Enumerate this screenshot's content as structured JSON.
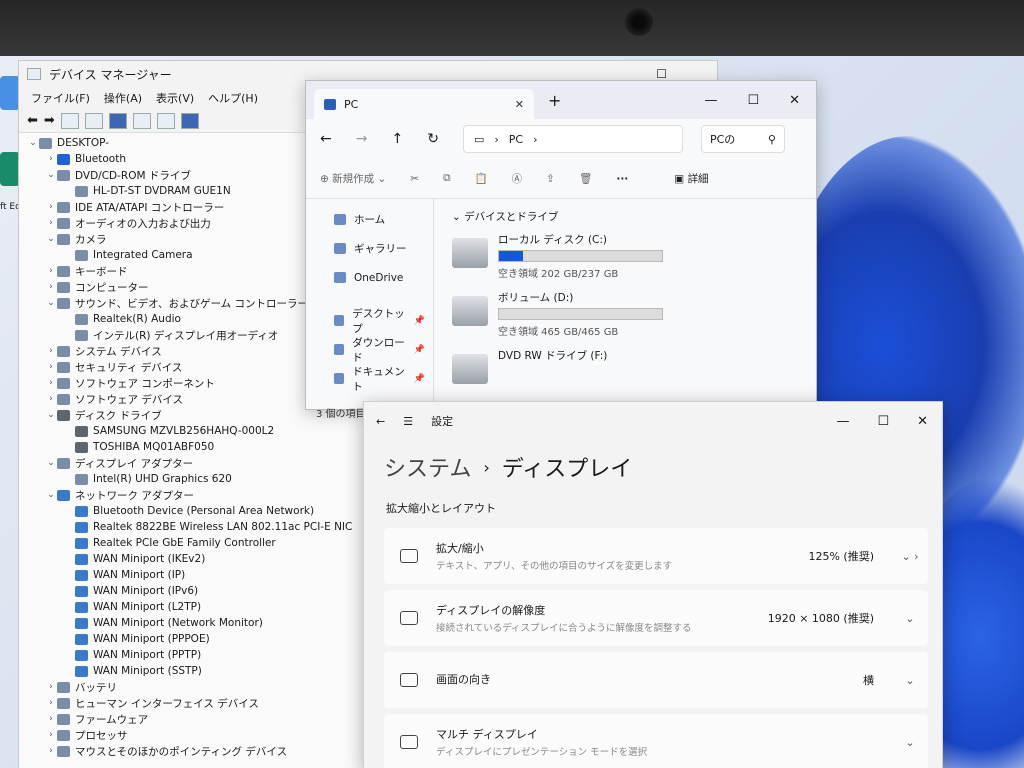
{
  "desktop": {
    "edge_label": "ft Edi"
  },
  "devmgr": {
    "title": "デバイス マネージャー",
    "menu": [
      "ファイル(F)",
      "操作(A)",
      "表示(V)",
      "ヘルプ(H)"
    ],
    "tree": [
      {
        "level": 0,
        "twisty": "v",
        "label": "DESKTOP-"
      },
      {
        "level": 1,
        "twisty": ">",
        "label": "Bluetooth",
        "icon": "bt"
      },
      {
        "level": 1,
        "twisty": "v",
        "label": "DVD/CD-ROM ドライブ"
      },
      {
        "level": 2,
        "twisty": "",
        "label": "HL-DT-ST DVDRAM GUE1N"
      },
      {
        "level": 1,
        "twisty": ">",
        "label": "IDE ATA/ATAPI コントローラー"
      },
      {
        "level": 1,
        "twisty": ">",
        "label": "オーディオの入力および出力"
      },
      {
        "level": 1,
        "twisty": "v",
        "label": "カメラ"
      },
      {
        "level": 2,
        "twisty": "",
        "label": "Integrated Camera"
      },
      {
        "level": 1,
        "twisty": ">",
        "label": "キーボード"
      },
      {
        "level": 1,
        "twisty": ">",
        "label": "コンピューター"
      },
      {
        "level": 1,
        "twisty": "v",
        "label": "サウンド、ビデオ、およびゲーム コントローラー"
      },
      {
        "level": 2,
        "twisty": "",
        "label": "Realtek(R) Audio"
      },
      {
        "level": 2,
        "twisty": "",
        "label": "インテル(R) ディスプレイ用オーディオ"
      },
      {
        "level": 1,
        "twisty": ">",
        "label": "システム デバイス"
      },
      {
        "level": 1,
        "twisty": ">",
        "label": "セキュリティ デバイス"
      },
      {
        "level": 1,
        "twisty": ">",
        "label": "ソフトウェア コンポーネント"
      },
      {
        "level": 1,
        "twisty": ">",
        "label": "ソフトウェア デバイス"
      },
      {
        "level": 1,
        "twisty": "v",
        "label": "ディスク ドライブ",
        "icon": "disk"
      },
      {
        "level": 2,
        "twisty": "",
        "label": "SAMSUNG MZVLB256HAHQ-000L2",
        "icon": "disk"
      },
      {
        "level": 2,
        "twisty": "",
        "label": "TOSHIBA MQ01ABF050",
        "icon": "disk"
      },
      {
        "level": 1,
        "twisty": "v",
        "label": "ディスプレイ アダプター"
      },
      {
        "level": 2,
        "twisty": "",
        "label": "Intel(R) UHD Graphics 620"
      },
      {
        "level": 1,
        "twisty": "v",
        "label": "ネットワーク アダプター",
        "icon": "net"
      },
      {
        "level": 2,
        "twisty": "",
        "label": "Bluetooth Device (Personal Area Network)",
        "icon": "net"
      },
      {
        "level": 2,
        "twisty": "",
        "label": "Realtek 8822BE Wireless LAN 802.11ac PCI-E NIC",
        "icon": "net"
      },
      {
        "level": 2,
        "twisty": "",
        "label": "Realtek PCIe GbE Family Controller",
        "icon": "net"
      },
      {
        "level": 2,
        "twisty": "",
        "label": "WAN Miniport (IKEv2)",
        "icon": "net"
      },
      {
        "level": 2,
        "twisty": "",
        "label": "WAN Miniport (IP)",
        "icon": "net"
      },
      {
        "level": 2,
        "twisty": "",
        "label": "WAN Miniport (IPv6)",
        "icon": "net"
      },
      {
        "level": 2,
        "twisty": "",
        "label": "WAN Miniport (L2TP)",
        "icon": "net"
      },
      {
        "level": 2,
        "twisty": "",
        "label": "WAN Miniport (Network Monitor)",
        "icon": "net"
      },
      {
        "level": 2,
        "twisty": "",
        "label": "WAN Miniport (PPPOE)",
        "icon": "net"
      },
      {
        "level": 2,
        "twisty": "",
        "label": "WAN Miniport (PPTP)",
        "icon": "net"
      },
      {
        "level": 2,
        "twisty": "",
        "label": "WAN Miniport (SSTP)",
        "icon": "net"
      },
      {
        "level": 1,
        "twisty": ">",
        "label": "バッテリ"
      },
      {
        "level": 1,
        "twisty": ">",
        "label": "ヒューマン インターフェイス デバイス"
      },
      {
        "level": 1,
        "twisty": ">",
        "label": "ファームウェア"
      },
      {
        "level": 1,
        "twisty": ">",
        "label": "プロセッサ"
      },
      {
        "level": 1,
        "twisty": ">",
        "label": "マウスとそのほかのポインティング デバイス"
      }
    ]
  },
  "explorer": {
    "tab_title": "PC",
    "address": "PC",
    "search_placeholder": "PCの",
    "new_label": "新規作成",
    "details_label": "詳細",
    "sidebar": [
      {
        "label": "ホーム",
        "pin": ""
      },
      {
        "label": "ギャラリー",
        "pin": ""
      },
      {
        "label": "OneDrive",
        "pin": ""
      },
      {
        "label": "デスクトップ",
        "pin": "📌"
      },
      {
        "label": "ダウンロード",
        "pin": "📌"
      },
      {
        "label": "ドキュメント",
        "pin": "📌"
      }
    ],
    "section": "デバイスとドライブ",
    "drives": [
      {
        "name": "ローカル ディスク (C:)",
        "free": "空き領域 202 GB/237 GB",
        "used_pct": 15,
        "bar": true
      },
      {
        "name": "ボリューム (D:)",
        "free": "空き領域 465 GB/465 GB",
        "used_pct": 0,
        "bar": true
      },
      {
        "name": "DVD RW ドライブ (F:)",
        "free": "",
        "used_pct": 0,
        "bar": false
      }
    ],
    "status": "3 個の項目"
  },
  "settings": {
    "app": "設定",
    "crumb_parent": "システム",
    "crumb_current": "ディスプレイ",
    "section": "拡大縮小とレイアウト",
    "items": [
      {
        "title": "拡大/縮小",
        "desc": "テキスト、アプリ、その他の項目のサイズを変更します",
        "value": "125% (推奨)",
        "chev": "⌄  ›"
      },
      {
        "title": "ディスプレイの解像度",
        "desc": "接続されているディスプレイに合うように解像度を調整する",
        "value": "1920 × 1080 (推奨)",
        "chev": "⌄"
      },
      {
        "title": "画面の向き",
        "desc": "",
        "value": "横",
        "chev": "⌄"
      },
      {
        "title": "マルチ ディスプレイ",
        "desc": "ディスプレイにプレゼンテーション モードを選択",
        "value": "",
        "chev": "⌄"
      }
    ]
  }
}
